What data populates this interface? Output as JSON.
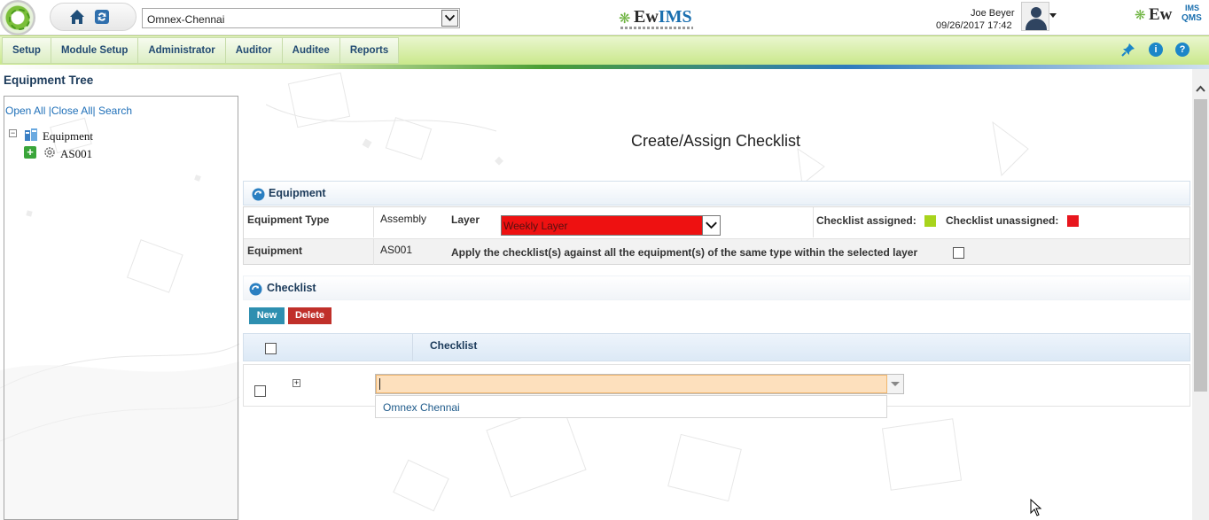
{
  "header": {
    "site_select_value": "Omnex-Chennai",
    "brand_center": {
      "ew": "Ew",
      "ims": "IMS"
    },
    "brand_right": {
      "ew": "Ew",
      "sup": "IMS",
      "sub": "QMS"
    },
    "user_name": "Joe Beyer",
    "datetime": "09/26/2017 17:42",
    "icons": [
      "home-icon",
      "refresh-icon",
      "user-avatar-icon"
    ]
  },
  "menu": {
    "items": [
      "Setup",
      "Module Setup",
      "Administrator",
      "Auditor",
      "Auditee",
      "Reports"
    ],
    "right_icons": [
      "pin-icon",
      "info-icon",
      "help-icon"
    ]
  },
  "tree": {
    "title": "Equipment Tree",
    "links": {
      "open_all": "Open All",
      "close_all": "Close All",
      "search": "Search"
    },
    "root_label": "Equipment",
    "child_label": "AS001"
  },
  "main": {
    "title": "Create/Assign Checklist",
    "equipment_section": {
      "heading": "Equipment",
      "equipment_type_label": "Equipment Type",
      "equipment_type_value": "Assembly",
      "layer_label": "Layer",
      "layer_value": "Weekly Layer",
      "assigned_label": "Checklist assigned:",
      "unassigned_label": "Checklist unassigned:",
      "assigned_color": "#a8d41c",
      "unassigned_color": "#e8161e",
      "equipment_label": "Equipment",
      "equipment_value": "AS001",
      "apply_text": "Apply the checklist(s) against all the equipment(s) of the same type within the selected layer"
    },
    "checklist_section": {
      "heading": "Checklist",
      "new_button": "New",
      "delete_button": "Delete",
      "column_header": "Checklist",
      "combo_value": "",
      "combo_option": "Omnex Chennai"
    }
  }
}
